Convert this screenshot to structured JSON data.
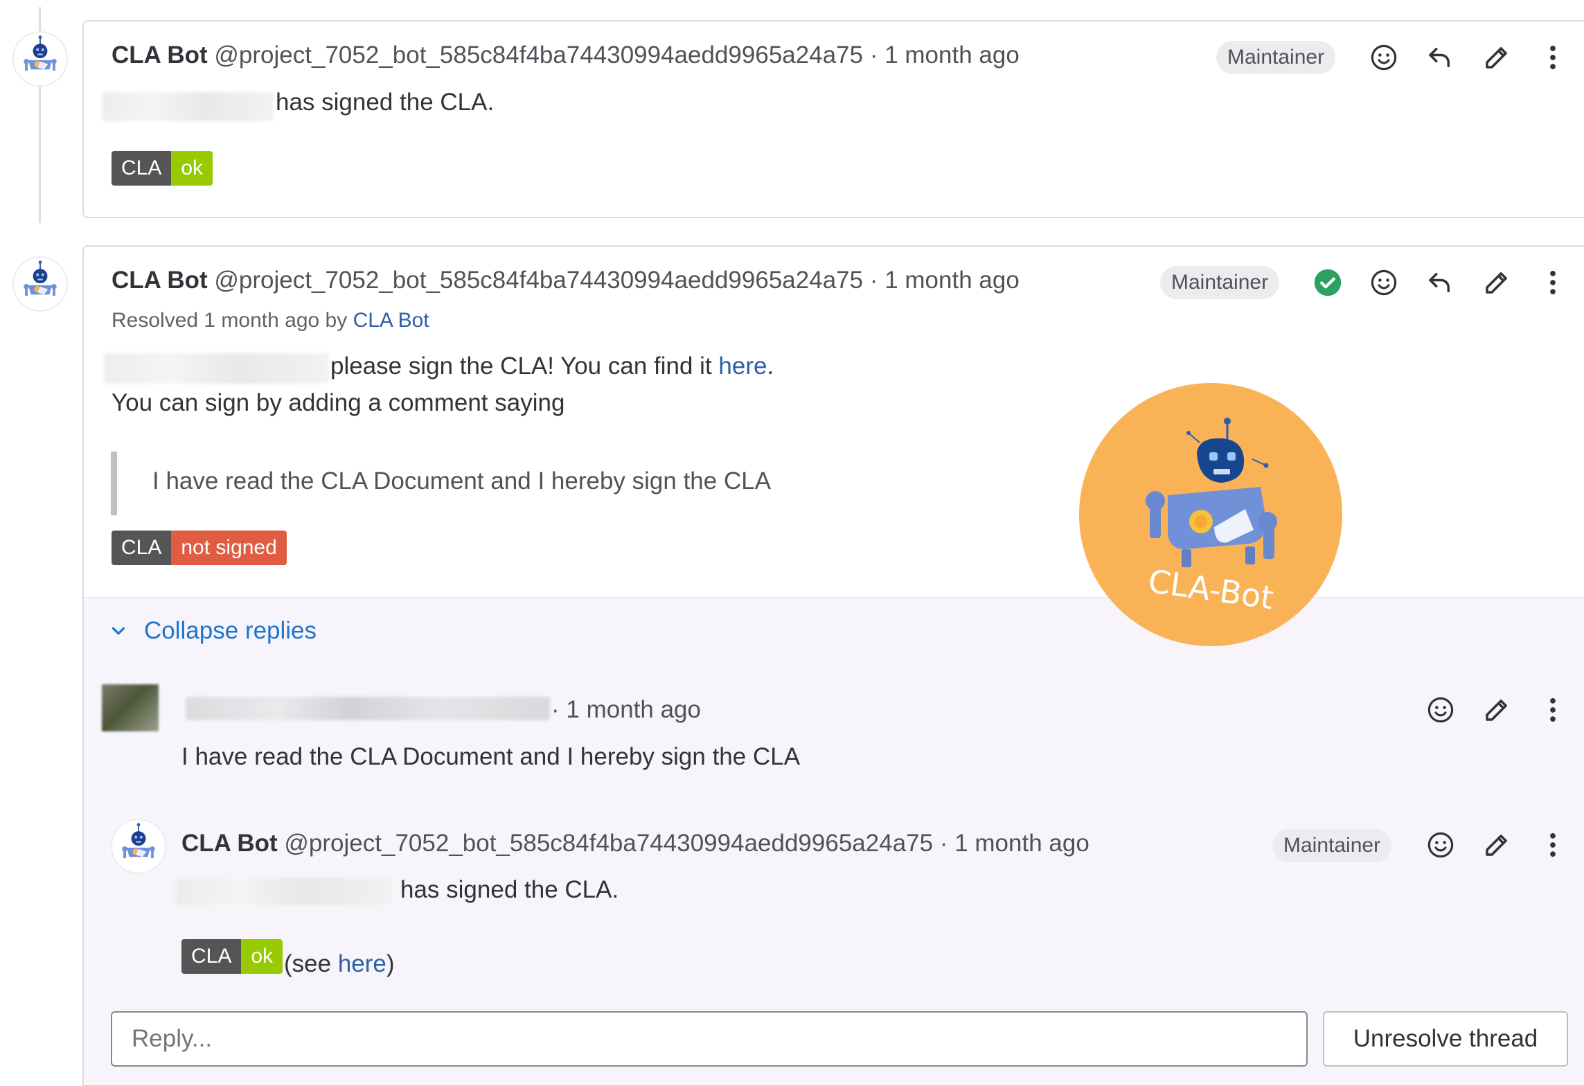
{
  "notes": [
    {
      "author_name": "CLA Bot",
      "author_handle": "@project_7052_bot_585c84f4ba74430994aedd9965a24a75",
      "time": "· 1 month ago",
      "role_badge": "Maintainer",
      "body": "has signed the CLA.",
      "shield_left": "CLA",
      "shield_right": "ok"
    },
    {
      "author_name": "CLA Bot",
      "author_handle": "@project_7052_bot_585c84f4ba74430994aedd9965a24a75",
      "time": "· 1 month ago",
      "role_badge": "Maintainer",
      "resolved_prefix": "Resolved 1 month ago by",
      "resolved_by": "CLA Bot",
      "body_line1": "please sign the CLA! You can find it",
      "body_link": "here",
      "body_line1_end": ".",
      "body_line2": "You can sign by adding a comment saying",
      "quote": "I have read the CLA Document and I hereby sign the CLA",
      "shield_left": "CLA",
      "shield_right": "not signed"
    }
  ],
  "thread": {
    "collapse_label": "Collapse replies",
    "replies": [
      {
        "time": "· 1 month ago",
        "body": "I have read the CLA Document and I hereby sign the CLA"
      },
      {
        "author_name": "CLA Bot",
        "author_handle": "@project_7052_bot_585c84f4ba74430994aedd9965a24a75",
        "time": "· 1 month ago",
        "role_badge": "Maintainer",
        "body": "has signed the CLA.",
        "shield_left": "CLA",
        "shield_right": "ok",
        "see_prefix": "(see",
        "see_link": "here",
        "see_suffix": ")"
      }
    ],
    "reply_placeholder": "Reply...",
    "unresolve_label": "Unresolve thread"
  },
  "sticker": {
    "label": "CLA-Bot"
  },
  "icons": {
    "emoji": "smile-icon",
    "reply": "reply-arrow-icon",
    "edit": "pencil-icon",
    "more": "kebab-menu-icon",
    "resolved": "check-circle-icon",
    "chevron": "chevron-down-icon"
  },
  "colors": {
    "link": "#1f75cb",
    "shield_ok": "#97ca00",
    "shield_bad": "#e05d44",
    "resolved_green": "#2da160",
    "sticker_bg": "#f9b356"
  }
}
